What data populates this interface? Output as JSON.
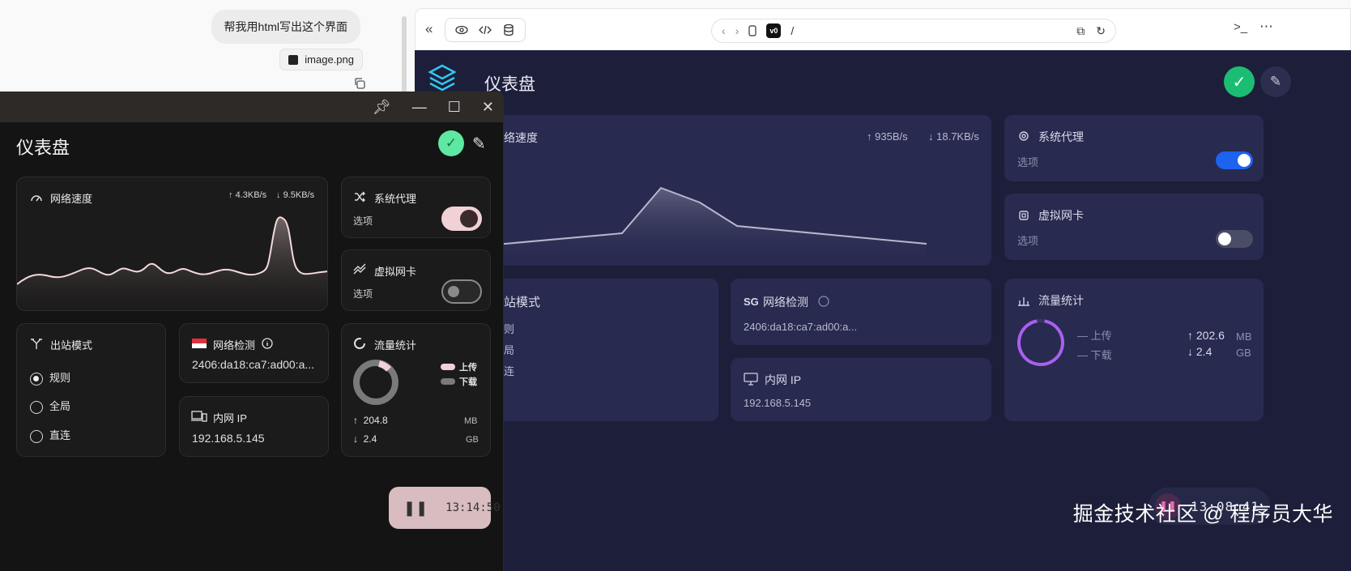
{
  "chat": {
    "message": "帮我用html写出这个界面",
    "attachment": "image.png"
  },
  "browser": {
    "url_path": "/",
    "logo_text": "v0"
  },
  "app": {
    "title": "仪表盘",
    "network_speed": {
      "label": "网络速度",
      "up": "935B/s",
      "down": "18.7KB/s",
      "label_partial": "络速度"
    },
    "system_proxy": {
      "label": "系统代理",
      "sub": "选项",
      "on": true
    },
    "virtual_nic": {
      "label": "虚拟网卡",
      "sub": "选项",
      "on": false
    },
    "outbound": {
      "label_partial": "站模式",
      "opts_partial": [
        "则",
        "局",
        "连"
      ]
    },
    "net_check": {
      "badge": "SG",
      "label": "网络检测",
      "ip": "2406:da18:ca7:ad00:a..."
    },
    "lan_ip": {
      "label": "内网 IP",
      "ip": "192.168.5.145"
    },
    "traffic": {
      "label": "流量统计",
      "legend_up": "— 上传",
      "legend_down": "— 下载",
      "up_val": "202.6",
      "up_unit": "MB",
      "down_val": "2.4",
      "down_unit": "GB"
    },
    "timer": "13:08:41",
    "accent_toggle": "#1e62f0",
    "accent_ok": "#1bbd73"
  },
  "watermark": "掘金技术社区 @ 程序员大华",
  "window": {
    "title": "仪表盘",
    "network_speed": {
      "label": "网络速度",
      "up": "4.3KB/s",
      "down": "9.5KB/s"
    },
    "system_proxy": {
      "label": "系统代理",
      "sub": "选项",
      "on": true
    },
    "virtual_nic": {
      "label": "虚拟网卡",
      "sub": "选项",
      "on": false
    },
    "outbound": {
      "label": "出站模式",
      "options": [
        "规则",
        "全局",
        "直连"
      ],
      "selected": 0
    },
    "net_check": {
      "label": "网络检测",
      "ip": "2406:da18:ca7:ad00:a..."
    },
    "lan_ip": {
      "label": "内网 IP",
      "ip": "192.168.5.145"
    },
    "traffic": {
      "label": "流量统计",
      "legend_up": "上传",
      "legend_down": "下载",
      "up_val": "204.8",
      "up_unit": "MB",
      "down_val": "2.4",
      "down_unit": "GB"
    },
    "timer": "13:14:50"
  }
}
